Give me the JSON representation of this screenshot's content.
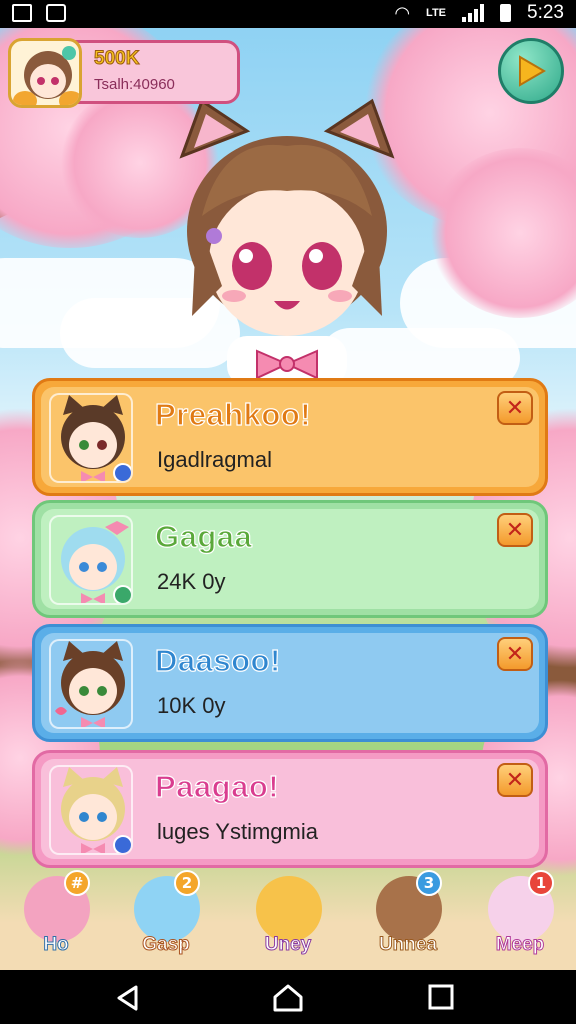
{
  "status_bar": {
    "time": "5:23",
    "network": "LTE",
    "icons": [
      "photo-icon",
      "download-icon",
      "wifi-icon",
      "signal-icon",
      "battery-icon"
    ]
  },
  "player": {
    "coins": "500K",
    "id_label": "Tsalh:40960"
  },
  "play_button": {
    "icon": "play-triangle-icon"
  },
  "notifications": [
    {
      "title": "Preahkoo!",
      "subtitle": "Igadlragmal",
      "color": "#f7a83a",
      "inner": "#fbc46a",
      "title_color": "#e07a14",
      "border": "#e07a14"
    },
    {
      "title": "Gagaa",
      "subtitle": "24K 0y",
      "color": "#9fe0a4",
      "inner": "#bff0c0",
      "title_color": "#5aa83a",
      "border": "#6fc77a"
    },
    {
      "title": "Daasoo!",
      "subtitle": "10K 0y",
      "color": "#5aaee8",
      "inner": "#8fcaf1",
      "title_color": "#2f86cf",
      "border": "#3d8fd4"
    },
    {
      "title": "Paagao!",
      "subtitle": "luges Ystimgmia",
      "color": "#f59ac4",
      "inner": "#f9bfda",
      "title_color": "#d93d8f",
      "border": "#e26aa4"
    }
  ],
  "close_glyph": "✕",
  "bottom_nav": [
    {
      "label": "Ho",
      "badge": "#",
      "badge_color": "#f4a62a",
      "pic": "#f3a3c0",
      "label_stroke": "#2f6fa8"
    },
    {
      "label": "Gasp",
      "badge": "2",
      "badge_color": "#f4a62a",
      "pic": "#8fd3f4",
      "label_stroke": "#a8521f"
    },
    {
      "label": "Uney",
      "badge": "",
      "badge_color": "",
      "pic": "#f7c24a",
      "label_stroke": "#8a3aa0"
    },
    {
      "label": "Unnea",
      "badge": "3",
      "badge_color": "#3a9be0",
      "pic": "#a8724a",
      "label_stroke": "#9a5a1f"
    },
    {
      "label": "Meep",
      "badge": "1",
      "badge_color": "#e8453a",
      "pic": "#f6d1ea",
      "label_stroke": "#b03a9a"
    }
  ]
}
